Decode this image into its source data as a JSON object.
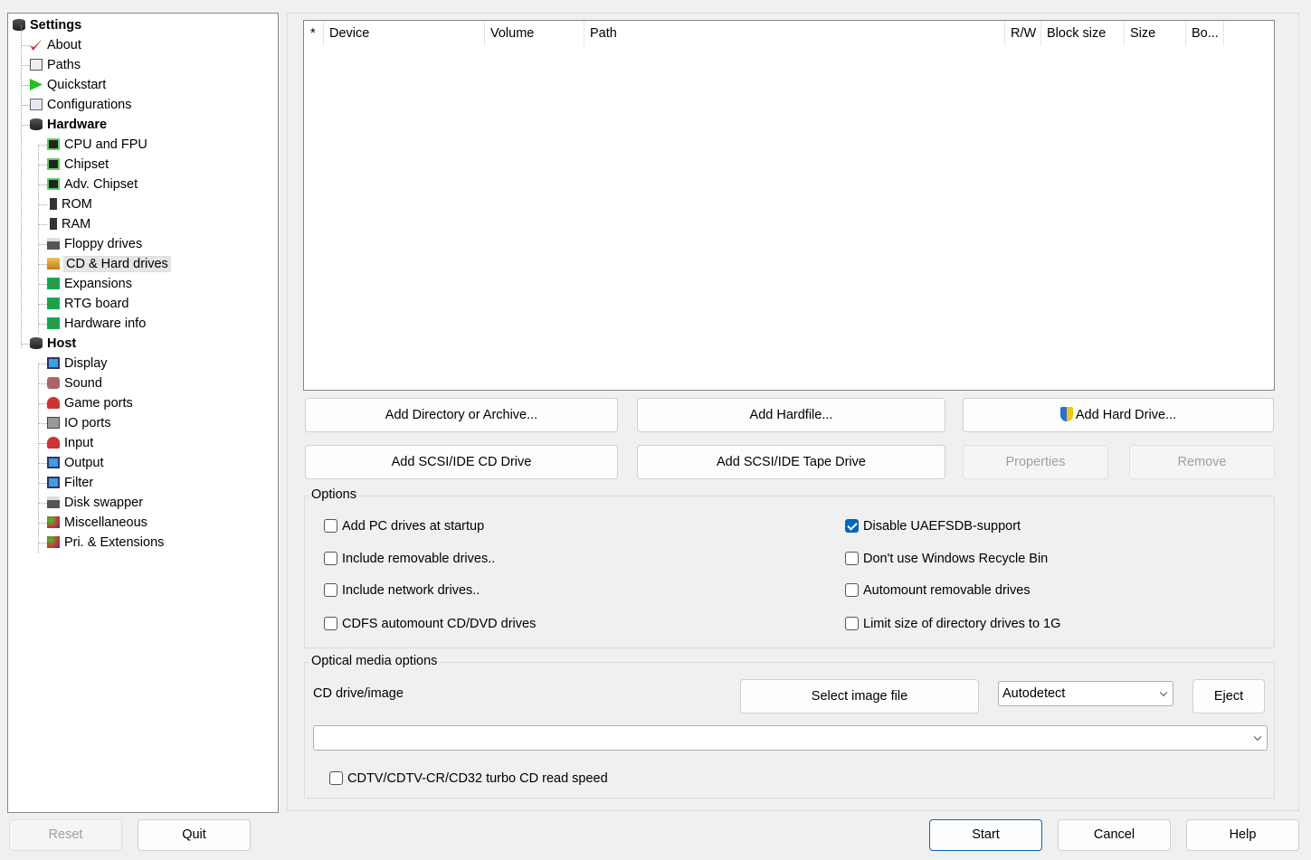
{
  "tree": [
    {
      "label": "Settings",
      "level": 0,
      "bold": true,
      "icon": "disk-stack-icon"
    },
    {
      "label": "About",
      "level": 1,
      "icon": "checkmark-icon"
    },
    {
      "label": "Paths",
      "level": 1,
      "icon": "paths-icon"
    },
    {
      "label": "Quickstart",
      "level": 1,
      "icon": "play-icon"
    },
    {
      "label": "Configurations",
      "level": 1,
      "icon": "config-icon"
    },
    {
      "label": "Hardware",
      "level": 1,
      "bold": true,
      "icon": "disk-stack-icon"
    },
    {
      "label": "CPU and FPU",
      "level": 2,
      "icon": "chip-icon"
    },
    {
      "label": "Chipset",
      "level": 2,
      "icon": "chip-icon"
    },
    {
      "label": "Adv. Chipset",
      "level": 2,
      "icon": "chip-icon"
    },
    {
      "label": "ROM",
      "level": 2,
      "icon": "memory-icon"
    },
    {
      "label": "RAM",
      "level": 2,
      "icon": "memory-icon"
    },
    {
      "label": "Floppy drives",
      "level": 2,
      "icon": "floppy-icon"
    },
    {
      "label": "CD & Hard drives",
      "level": 2,
      "icon": "drive-icon",
      "selected": true
    },
    {
      "label": "Expansions",
      "level": 2,
      "icon": "board-icon"
    },
    {
      "label": "RTG board",
      "level": 2,
      "icon": "board-icon"
    },
    {
      "label": "Hardware info",
      "level": 2,
      "icon": "board-icon"
    },
    {
      "label": "Host",
      "level": 1,
      "bold": true,
      "icon": "disk-stack-icon"
    },
    {
      "label": "Display",
      "level": 2,
      "icon": "monitor-icon"
    },
    {
      "label": "Sound",
      "level": 2,
      "icon": "speaker-icon"
    },
    {
      "label": "Game ports",
      "level": 2,
      "icon": "joystick-icon"
    },
    {
      "label": "IO ports",
      "level": 2,
      "icon": "port-icon"
    },
    {
      "label": "Input",
      "level": 2,
      "icon": "joystick-icon"
    },
    {
      "label": "Output",
      "level": 2,
      "icon": "monitor-icon"
    },
    {
      "label": "Filter",
      "level": 2,
      "icon": "monitor-icon"
    },
    {
      "label": "Disk swapper",
      "level": 2,
      "icon": "floppy-icon"
    },
    {
      "label": "Miscellaneous",
      "level": 2,
      "icon": "misc-icon"
    },
    {
      "label": "Pri. & Extensions",
      "level": 2,
      "icon": "misc-icon"
    }
  ],
  "list": {
    "columns": [
      "*",
      "Device",
      "Volume",
      "Path",
      "R/W",
      "Block size",
      "Size",
      "Bo..."
    ]
  },
  "buttons": {
    "add_dir": "Add Directory or Archive...",
    "add_hardfile": "Add Hardfile...",
    "add_hd": "Add Hard Drive...",
    "add_cd": "Add SCSI/IDE CD Drive",
    "add_tape": "Add SCSI/IDE Tape Drive",
    "properties": "Properties",
    "remove": "Remove"
  },
  "options": {
    "title": "Options",
    "left": [
      {
        "label": "Add PC drives at startup",
        "checked": false
      },
      {
        "label": "Include removable drives..",
        "checked": false
      },
      {
        "label": "Include network drives..",
        "checked": false
      },
      {
        "label": "CDFS automount CD/DVD drives",
        "checked": false
      }
    ],
    "right": [
      {
        "label": "Disable UAEFSDB-support",
        "checked": true
      },
      {
        "label": "Don't use Windows Recycle Bin",
        "checked": false
      },
      {
        "label": "Automount removable drives",
        "checked": false
      },
      {
        "label": "Limit size of directory drives to 1G",
        "checked": false
      }
    ]
  },
  "optical": {
    "title": "Optical media options",
    "cd_label": "CD drive/image",
    "select_image": "Select image file",
    "mode": "Autodetect",
    "eject": "Eject",
    "path": "",
    "turbo": "CDTV/CDTV-CR/CD32 turbo CD read speed",
    "turbo_checked": false
  },
  "footer": {
    "reset": "Reset",
    "quit": "Quit",
    "start": "Start",
    "cancel": "Cancel",
    "help": "Help"
  },
  "colors": {
    "accent": "#0067c0"
  }
}
